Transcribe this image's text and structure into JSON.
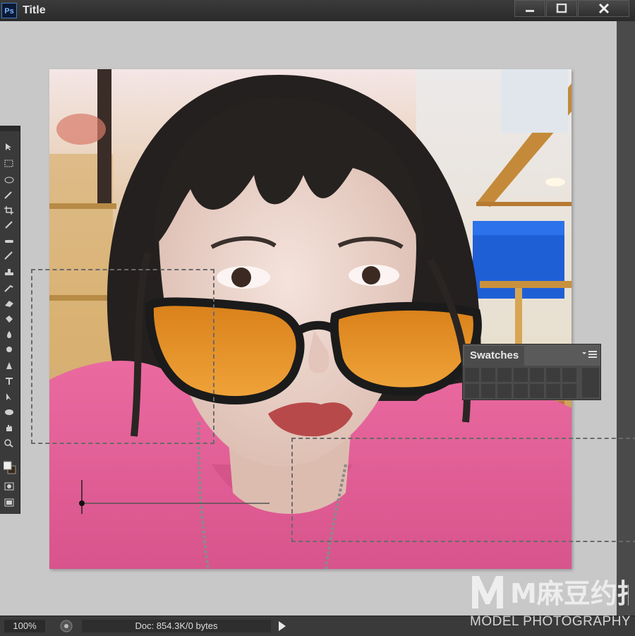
{
  "window": {
    "app_icon": "ps-icon",
    "app_icon_text": "Ps",
    "title": "Title",
    "controls": [
      "minimize-icon",
      "maximize-icon",
      "close-icon"
    ]
  },
  "tools_panel": {
    "tools": [
      "move-tool",
      "marquee-tool",
      "lasso-tool",
      "magic-wand-tool",
      "crop-tool",
      "eyedropper-tool",
      "healing-brush-tool",
      "brush-tool",
      "clone-stamp-tool",
      "history-brush-tool",
      "eraser-tool",
      "paint-bucket-tool",
      "blur-tool",
      "dodge-tool",
      "pen-tool",
      "type-tool",
      "path-selection-tool",
      "shape-tool",
      "hand-tool",
      "zoom-tool",
      "color-swatches",
      "quick-mask",
      "screen-mode"
    ]
  },
  "swatches_panel": {
    "title": "Swatches",
    "menu_icon": "panel-menu-icon"
  },
  "status_bar": {
    "zoom": "100%",
    "doc_info": "Doc: 854.3K/0 bytes"
  },
  "watermark": {
    "logo_text": "M麻豆约拍",
    "subtitle": "MODEL PHOTOGRAPHY"
  },
  "colors": {
    "titlebar": "#2f2f2f",
    "workspace": "#c8c8c8",
    "panel": "#4b4b4b",
    "shirt_pink": "#e8629a",
    "lens_orange": "#e8901e"
  }
}
